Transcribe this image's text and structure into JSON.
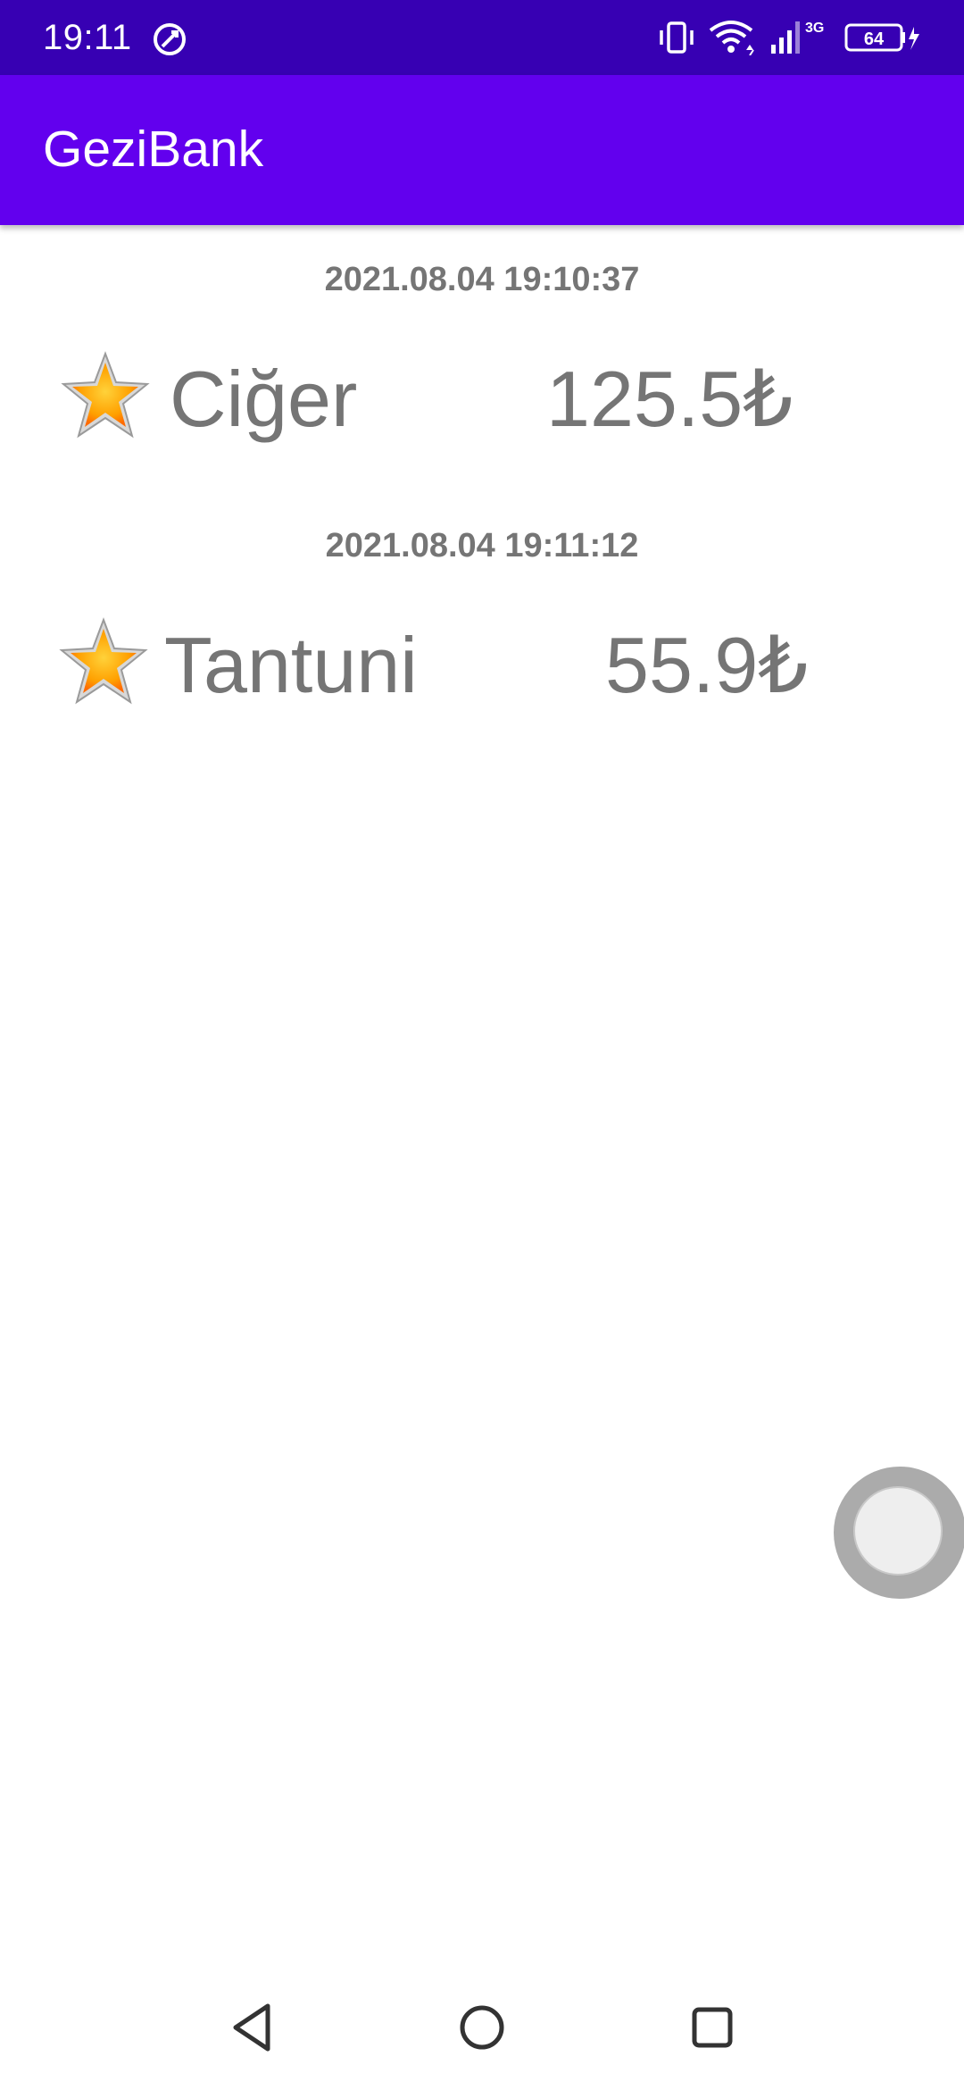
{
  "status_bar": {
    "time": "19:11",
    "network_label": "3G",
    "battery_level": "64"
  },
  "app_bar": {
    "title": "GeziBank"
  },
  "entries": [
    {
      "date": "2021.08.04 19:10:37",
      "name": "Ciğer",
      "price": "125.5₺",
      "icon": "star-icon"
    },
    {
      "date": "2021.08.04 19:11:12",
      "name": "Tantuni",
      "price": "55.9₺",
      "icon": "star-icon"
    }
  ],
  "colors": {
    "status_bar": "#3700b3",
    "app_bar": "#6200ee",
    "text_gray": "#757575"
  },
  "nav_bar": {
    "back": "back-icon",
    "home": "home-icon",
    "recents": "recents-icon"
  }
}
